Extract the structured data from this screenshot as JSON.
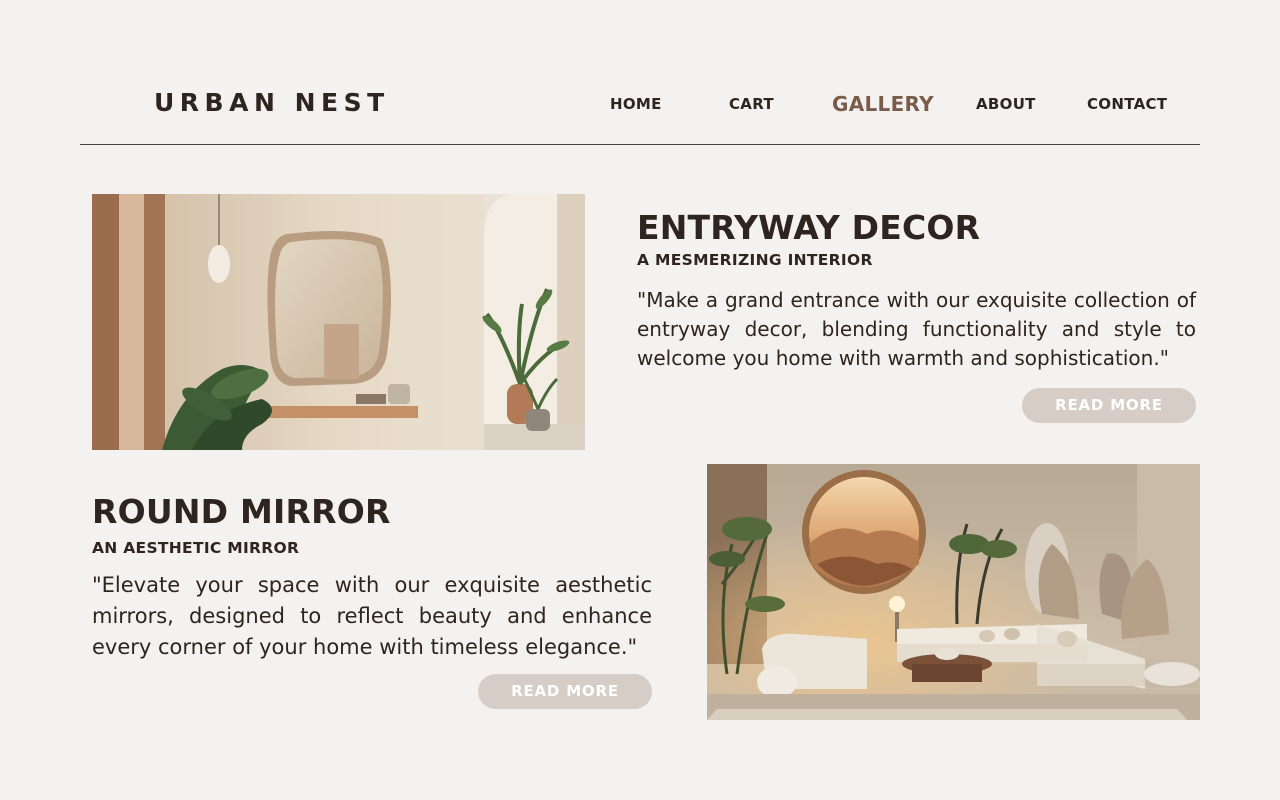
{
  "brand": {
    "name": "URBAN NEST"
  },
  "nav": {
    "items": [
      {
        "label": "HOME"
      },
      {
        "label": "CART"
      },
      {
        "label": "GALLERY",
        "active": true
      },
      {
        "label": "ABOUT"
      },
      {
        "label": "CONTACT"
      }
    ],
    "active_color": "#7a5c4a"
  },
  "cards": [
    {
      "title": "ENTRYWAY DECOR",
      "subtitle": "A MESMERIZING INTERIOR",
      "text": "\"Make a grand entrance with our exquisite collection of entryway decor, blending functionality and style to welcome you home with warmth and sophistication.\"",
      "button": "READ MORE"
    },
    {
      "title": "ROUND MIRROR",
      "subtitle": "AN AESTHETIC MIRROR",
      "text": "\"Elevate your space with our exquisite aesthetic mirrors, designed to reflect beauty and enhance every corner of your home with timeless elegance.\"",
      "button": "READ MORE"
    }
  ],
  "colors": {
    "background": "#f4f2f0",
    "text": "#2e2420",
    "button": "#d5cdc6"
  }
}
